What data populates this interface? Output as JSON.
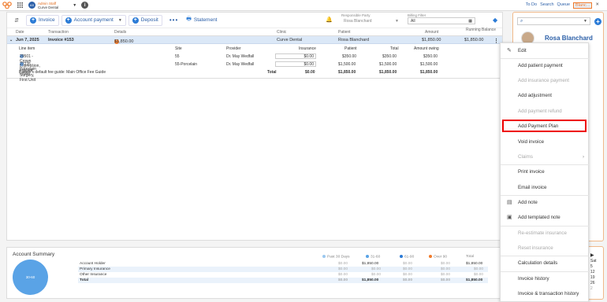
{
  "topbar": {
    "user_initials": "AS",
    "user_name": "Admin Staff",
    "clinic": "Curve Dental",
    "links": [
      "To Do",
      "Search",
      "Queue"
    ],
    "active_tab": "Blanc..."
  },
  "toolbar": {
    "invoice": "Invoice",
    "account_payment": "Account payment",
    "deposit": "Deposit",
    "statement": "Statement",
    "responsible_party_label": "Responsible Party",
    "responsible_party_value": "Rosa Blanchard",
    "billing_filter_label": "Billing Filter",
    "billing_filter_value": "All"
  },
  "columns": [
    "Date",
    "Transaction",
    "Details",
    "Clinic",
    "Patient",
    "Amount",
    "Running Balance"
  ],
  "invoice_row": {
    "date": "Jun 7, 2025",
    "transaction": "Invoice #153",
    "details": "$1,850.00",
    "clinic": "Curve Dental",
    "patient": "Rosa Blanchard",
    "amount": "$1,850.00",
    "balance": "$1,850.00"
  },
  "line_items": {
    "headers": [
      "Line item",
      "Site",
      "Provider",
      "Insurance",
      "Patient",
      "Total",
      "Amount owing"
    ],
    "rows": [
      {
        "item": "29501 - Crown Impression, Implant Surgery, First Unit",
        "site": "55",
        "provider": "Dr. May Wedfall",
        "insurance": "$0.00",
        "patient": "$350.00",
        "total": "$350.00",
        "owing": "$350.00"
      },
      {
        "item": "27235 - Porcelain crown",
        "site": "55-Porcelain",
        "provider": "Dr. May Wedfall",
        "insurance": "$0.00",
        "patient": "$1,500.00",
        "total": "$1,500.00",
        "owing": "$1,500.00"
      }
    ],
    "fee_guide": "Patient's default fee guide: Main Office Fee Guide",
    "total_label": "Total",
    "total_insurance": "$0.00",
    "total_patient": "$1,850.00",
    "total_total": "$1,850.00",
    "total_owing": "$1,850.00"
  },
  "summary": {
    "title": "Account Summary",
    "pie_label": "30-60",
    "legend": [
      "Past 30 Days",
      "31-60",
      "61-90",
      "Over 90",
      "Total"
    ],
    "rows": [
      {
        "name": "Account Holder",
        "v": [
          "$0.00",
          "$1,850.00",
          "$0.00",
          "$0.00",
          "$1,850.00"
        ]
      },
      {
        "name": "Primary Insurance",
        "v": [
          "$0.00",
          "$0.00",
          "$0.00",
          "$0.00",
          "$0.00"
        ]
      },
      {
        "name": "Other Insurance",
        "v": [
          "$0.00",
          "$0.00",
          "$0.00",
          "$0.00",
          "$0.00"
        ]
      },
      {
        "name": "Total",
        "v": [
          "$0.00",
          "$1,850.00",
          "$0.00",
          "$0.00",
          "$1,850.00"
        ]
      }
    ]
  },
  "patient_panel": {
    "name": "Rosa Blanchard",
    "calendar": [
      "Sat",
      "5",
      "12",
      "19",
      "26",
      "2"
    ]
  },
  "menu": {
    "items": [
      {
        "label": "Edit",
        "disabled": false
      },
      {
        "label": "Add patient payment",
        "disabled": false
      },
      {
        "label": "Add insurance payment",
        "disabled": true
      },
      {
        "label": "Add adjustment",
        "disabled": false
      },
      {
        "label": "Add payment refund",
        "disabled": true
      },
      {
        "label": "Add Payment Plan",
        "disabled": false
      },
      {
        "label": "Void invoice",
        "disabled": false
      },
      {
        "label": "Claims",
        "disabled": true
      },
      {
        "label": "Print invoice",
        "disabled": false
      },
      {
        "label": "Email invoice",
        "disabled": false
      },
      {
        "label": "Add note",
        "disabled": false
      },
      {
        "label": "Add templated note",
        "disabled": false
      },
      {
        "label": "Re-estimate insurance",
        "disabled": true
      },
      {
        "label": "Reset insurance",
        "disabled": true
      },
      {
        "label": "Calculation details",
        "disabled": false
      },
      {
        "label": "Invoice history",
        "disabled": false
      },
      {
        "label": "Invoice & transaction history",
        "disabled": false
      }
    ]
  },
  "colors": {
    "accent": "#2b7bd6",
    "brand_orange": "#f07a2a",
    "highlight": "#e00000"
  }
}
